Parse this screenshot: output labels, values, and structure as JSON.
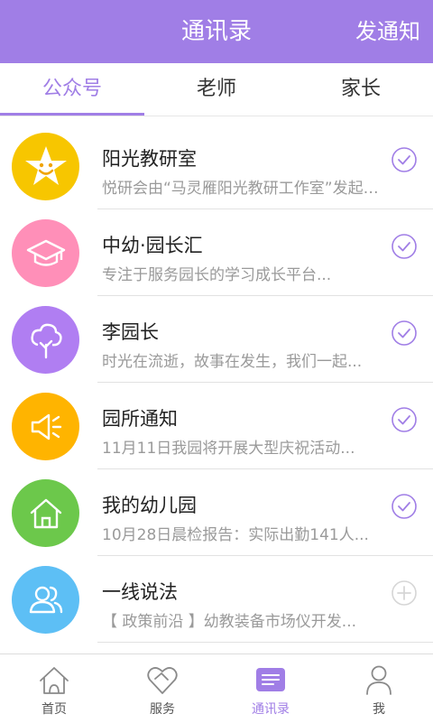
{
  "header": {
    "title": "通讯录",
    "action": "发通知"
  },
  "tabs": [
    {
      "label": "公众号",
      "active": true
    },
    {
      "label": "老师",
      "active": false
    },
    {
      "label": "家长",
      "active": false
    }
  ],
  "accounts": [
    {
      "title": "阳光教研室",
      "subtitle": "悦研会由“马灵雁阳光教研工作室”发起成立",
      "avatar_color": "#f7c600",
      "icon": "star-face-icon",
      "status": "subscribed"
    },
    {
      "title": "中幼·园长汇",
      "subtitle": "专注于服务园长的学习成长平台...",
      "avatar_color": "#ff8fb8",
      "icon": "graduation-cap-icon",
      "status": "subscribed"
    },
    {
      "title": "李园长",
      "subtitle": "时光在流逝，故事在发生，我们一起...",
      "avatar_color": "#b07ef2",
      "icon": "tree-icon",
      "status": "subscribed"
    },
    {
      "title": "园所通知",
      "subtitle": "11月11日我园将开展大型庆祝活动...",
      "avatar_color": "#ffb400",
      "icon": "megaphone-icon",
      "status": "subscribed"
    },
    {
      "title": "我的幼儿园",
      "subtitle": "10月28日晨检报告：实际出勤141人...",
      "avatar_color": "#6cc84b",
      "icon": "home-icon",
      "status": "subscribed"
    },
    {
      "title": "一线说法",
      "subtitle": "【 政策前沿 】幼教装备市场仪开发...",
      "avatar_color": "#5dbff5",
      "icon": "people-icon",
      "status": "not-subscribed"
    }
  ],
  "bottom_nav": [
    {
      "label": "首页",
      "icon": "home-outline-icon",
      "active": false
    },
    {
      "label": "服务",
      "icon": "heart-hands-icon",
      "active": false
    },
    {
      "label": "通讯录",
      "icon": "contacts-icon",
      "active": true
    },
    {
      "label": "我",
      "icon": "person-icon",
      "active": false
    }
  ],
  "colors": {
    "accent": "#a07ee6",
    "header_text": "#ffffff",
    "subtitle": "#9a9a9a"
  }
}
